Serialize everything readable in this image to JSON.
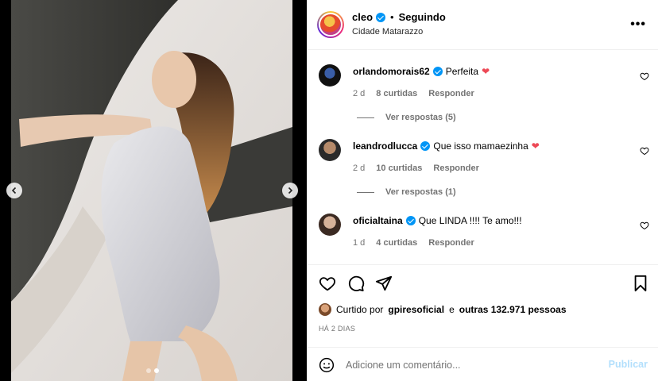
{
  "header": {
    "username": "cleo",
    "separator": "•",
    "follow_label": "Seguindo",
    "location": "Cidade Matarazzo",
    "more_icon": "more-horizontal-icon"
  },
  "comments": [
    {
      "username": "orlandomorais62",
      "text": "Perfeita",
      "emoji": "❤",
      "age": "2 d",
      "likes": "8 curtidas",
      "reply_label": "Responder",
      "view_replies": "Ver respostas (5)"
    },
    {
      "username": "leandrodlucca",
      "text": "Que isso mamaezinha",
      "emoji": "❤",
      "age": "2 d",
      "likes": "10 curtidas",
      "reply_label": "Responder",
      "view_replies": "Ver respostas (1)"
    },
    {
      "username": "oficialtaina",
      "text": "Que LINDA !!!! Te amo!!!",
      "emoji": "",
      "age": "1 d",
      "likes": "4 curtidas",
      "reply_label": "Responder"
    }
  ],
  "likes": {
    "prefix": "Curtido por",
    "user": "gpiresoficial",
    "middle": "e",
    "others": "outras 132.971 pessoas"
  },
  "date": "HÁ 2 DIAS",
  "compose": {
    "placeholder": "Adicione um comentário...",
    "publish_label": "Publicar"
  },
  "media": {
    "slide_count": 2,
    "active_slide": 2
  },
  "colors": {
    "verified": "#0095f6",
    "heart": "#ed4956",
    "publish_disabled": "#b2dffc",
    "meta_text": "#737373"
  }
}
